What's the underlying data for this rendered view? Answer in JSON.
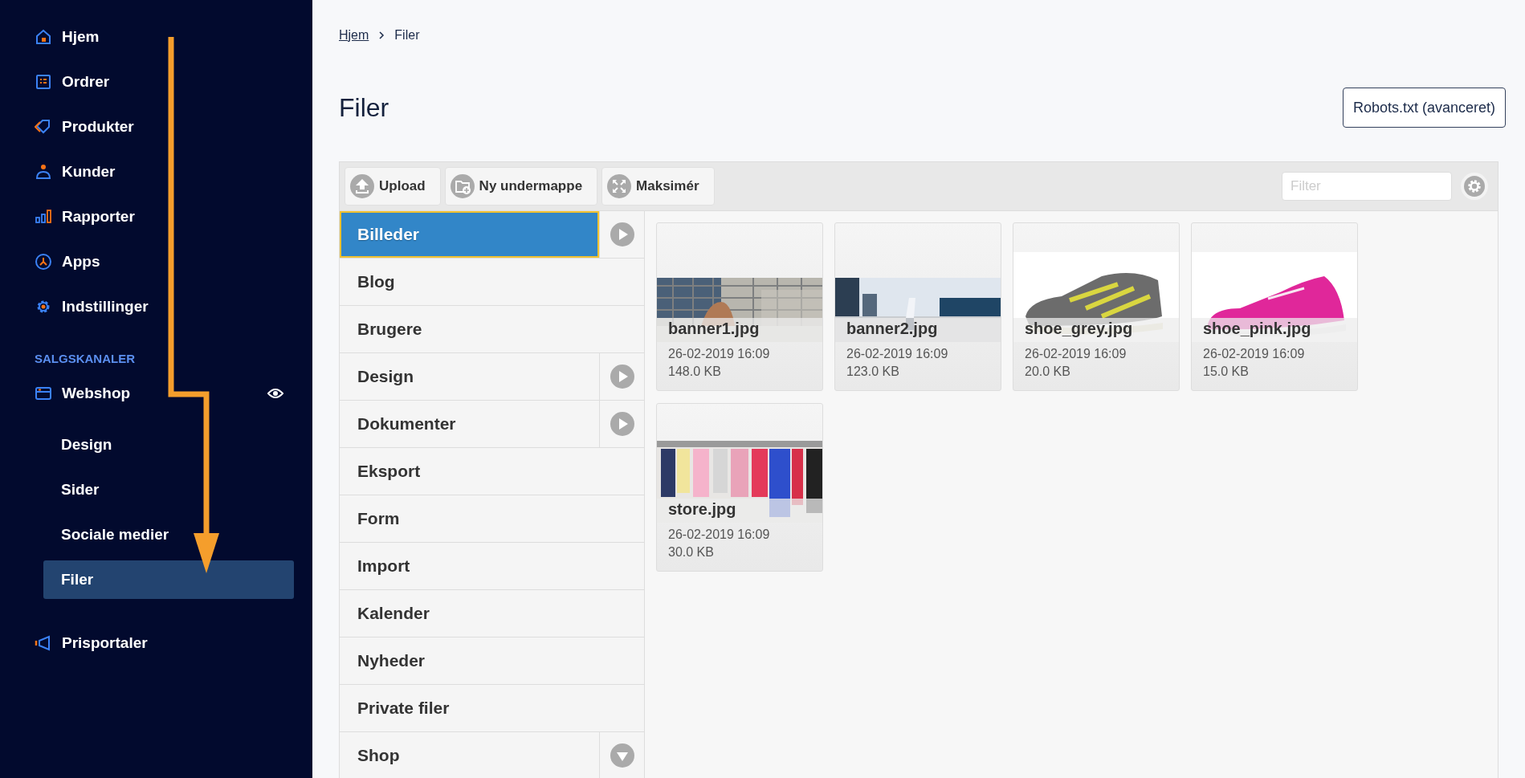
{
  "sidebar": {
    "items": [
      {
        "label": "Hjem"
      },
      {
        "label": "Ordrer"
      },
      {
        "label": "Produkter"
      },
      {
        "label": "Kunder"
      },
      {
        "label": "Rapporter"
      },
      {
        "label": "Apps"
      },
      {
        "label": "Indstillinger"
      }
    ],
    "section_title": "SALGSKANALER",
    "channel": {
      "label": "Webshop",
      "children": [
        {
          "label": "Design",
          "selected": false
        },
        {
          "label": "Sider",
          "selected": false
        },
        {
          "label": "Sociale medier",
          "selected": false
        },
        {
          "label": "Filer",
          "selected": true
        }
      ]
    },
    "bottom_items": [
      {
        "label": "Prisportaler"
      }
    ]
  },
  "breadcrumb": [
    {
      "label": "Hjem",
      "kind": "link"
    },
    {
      "label": "Filer",
      "kind": "current"
    }
  ],
  "page_title": "Filer",
  "header_button": "Robots.txt (avanceret)",
  "toolbar": {
    "buttons": [
      {
        "label": "Upload"
      },
      {
        "label": "Ny undermappe"
      },
      {
        "label": "Maksimér"
      }
    ],
    "filter": {
      "placeholder": "Filter"
    }
  },
  "folders": [
    {
      "label": "Billeder",
      "selected": true,
      "kind": "expandable"
    },
    {
      "label": "Blog",
      "selected": false,
      "kind": "plain"
    },
    {
      "label": "Brugere",
      "selected": false,
      "kind": "plain"
    },
    {
      "label": "Design",
      "selected": false,
      "kind": "expandable"
    },
    {
      "label": "Dokumenter",
      "selected": false,
      "kind": "expandable"
    },
    {
      "label": "Eksport",
      "selected": false,
      "kind": "plain"
    },
    {
      "label": "Form",
      "selected": false,
      "kind": "plain"
    },
    {
      "label": "Import",
      "selected": false,
      "kind": "plain"
    },
    {
      "label": "Kalender",
      "selected": false,
      "kind": "plain"
    },
    {
      "label": "Nyheder",
      "selected": false,
      "kind": "plain"
    },
    {
      "label": "Private filer",
      "selected": false,
      "kind": "plain"
    },
    {
      "label": "Shop",
      "selected": false,
      "kind": "dropdown"
    }
  ],
  "files": [
    {
      "name": "banner1.jpg",
      "date": "26-02-2019 16:09",
      "size": "148.0 KB"
    },
    {
      "name": "banner2.jpg",
      "date": "26-02-2019 16:09",
      "size": "123.0 KB"
    },
    {
      "name": "shoe_grey.jpg",
      "date": "26-02-2019 16:09",
      "size": "20.0 KB"
    },
    {
      "name": "shoe_pink.jpg",
      "date": "26-02-2019 16:09",
      "size": "15.0 KB"
    },
    {
      "name": "store.jpg",
      "date": "26-02-2019 16:09",
      "size": "30.0 KB"
    }
  ]
}
